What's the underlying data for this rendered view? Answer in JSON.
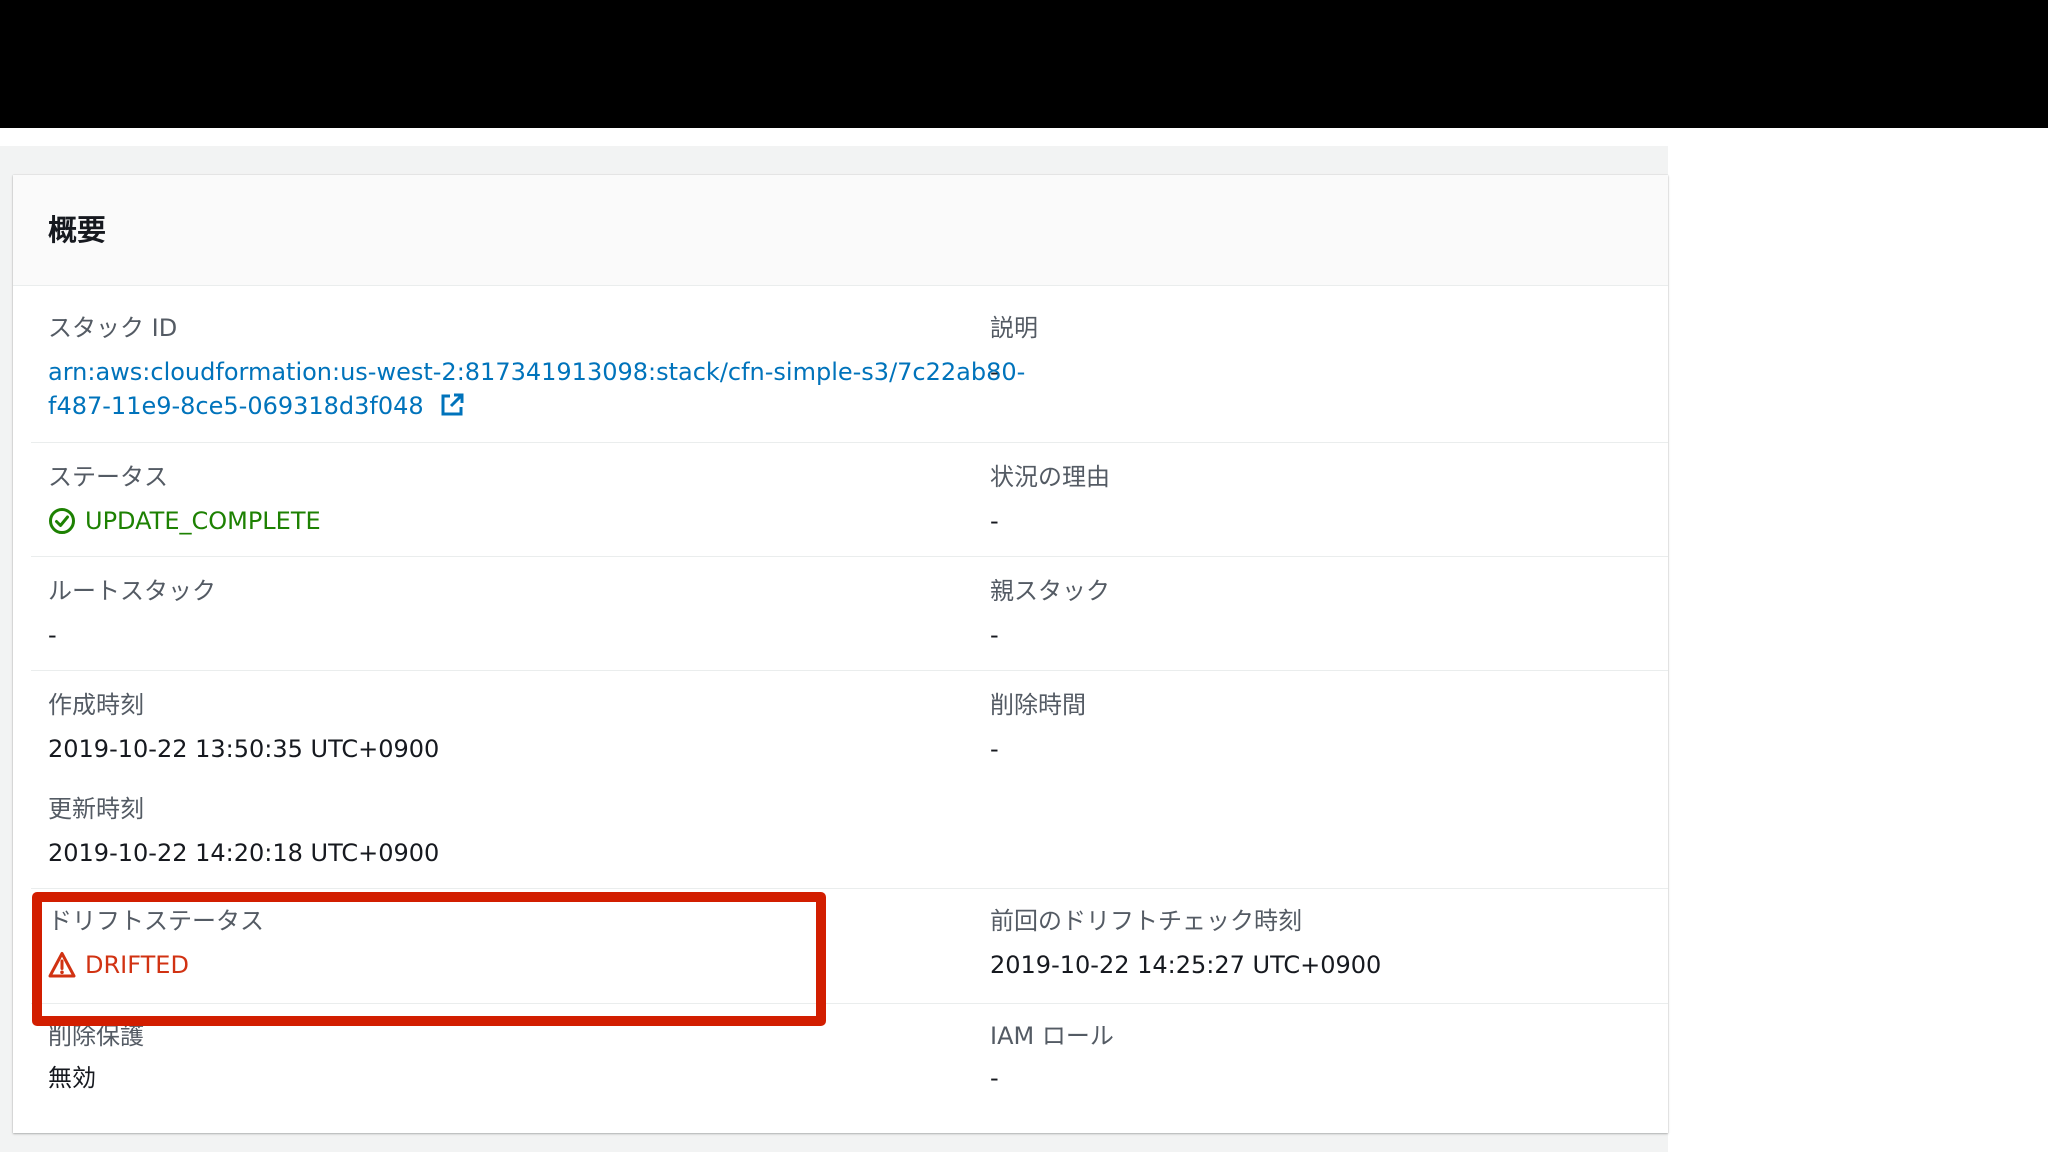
{
  "panel": {
    "title": "概要"
  },
  "fields": {
    "stack_id": {
      "label": "スタック ID",
      "value_line1": "arn:aws:cloudformation:us-west-2:817341913098:stack/cfn-simple-s3/7c22ab80-",
      "value_line2": "f487-11e9-8ce5-069318d3f048"
    },
    "description": {
      "label": "説明",
      "value": "-"
    },
    "status": {
      "label": "ステータス",
      "value": "UPDATE_COMPLETE"
    },
    "status_reason": {
      "label": "状況の理由",
      "value": "-"
    },
    "root_stack": {
      "label": "ルートスタック",
      "value": "-"
    },
    "parent_stack": {
      "label": "親スタック",
      "value": "-"
    },
    "created_time": {
      "label": "作成時刻",
      "value": "2019-10-22 13:50:35 UTC+0900"
    },
    "deleted_time": {
      "label": "削除時間",
      "value": "-"
    },
    "updated_time": {
      "label": "更新時刻",
      "value": "2019-10-22 14:20:18 UTC+0900"
    },
    "drift_status": {
      "label": "ドリフトステータス",
      "value": "DRIFTED"
    },
    "last_drift_check": {
      "label": "前回のドリフトチェック時刻",
      "value": "2019-10-22 14:25:27 UTC+0900"
    },
    "termination_protection": {
      "label": "削除保護",
      "value": "無効"
    },
    "iam_role": {
      "label": "IAM ロール",
      "value": "-"
    }
  },
  "icons": {
    "external_link": "external-link-icon",
    "status_ok": "check-circle-icon",
    "status_drifted": "warning-triangle-icon"
  },
  "colors": {
    "link": "#0073bb",
    "success": "#1d8102",
    "error": "#d13212",
    "highlight": "#d21e00"
  }
}
